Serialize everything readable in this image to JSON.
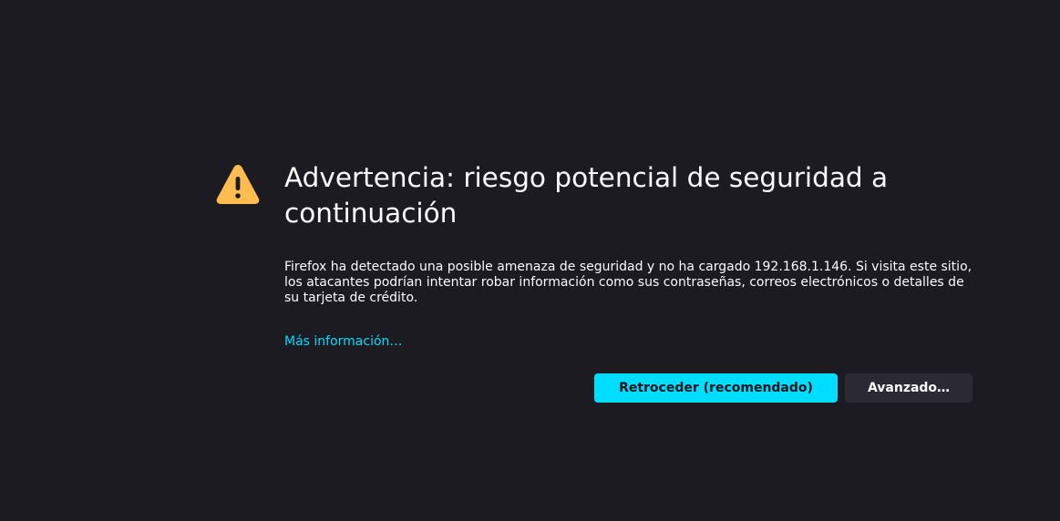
{
  "error_page": {
    "title": "Advertencia: riesgo potencial de seguridad a continuación",
    "description": "Firefox ha detectado una posible amenaza de seguridad y no ha cargado 192.168.1.146. Si visita este sitio, los atacantes podrían intentar robar información como sus contraseñas, correos electrónicos o detalles de su tarjeta de crédito.",
    "more_info_link": "Más información…",
    "icon": "warning-icon"
  },
  "buttons": {
    "go_back_label": "Retroceder (recomendado)",
    "advanced_label": "Avanzado…"
  },
  "colors": {
    "background": "#1c1b22",
    "text": "#fbfbfe",
    "accent": "#00ddff",
    "warning": "#ffbd4f",
    "secondary_button": "#2b2a33"
  }
}
